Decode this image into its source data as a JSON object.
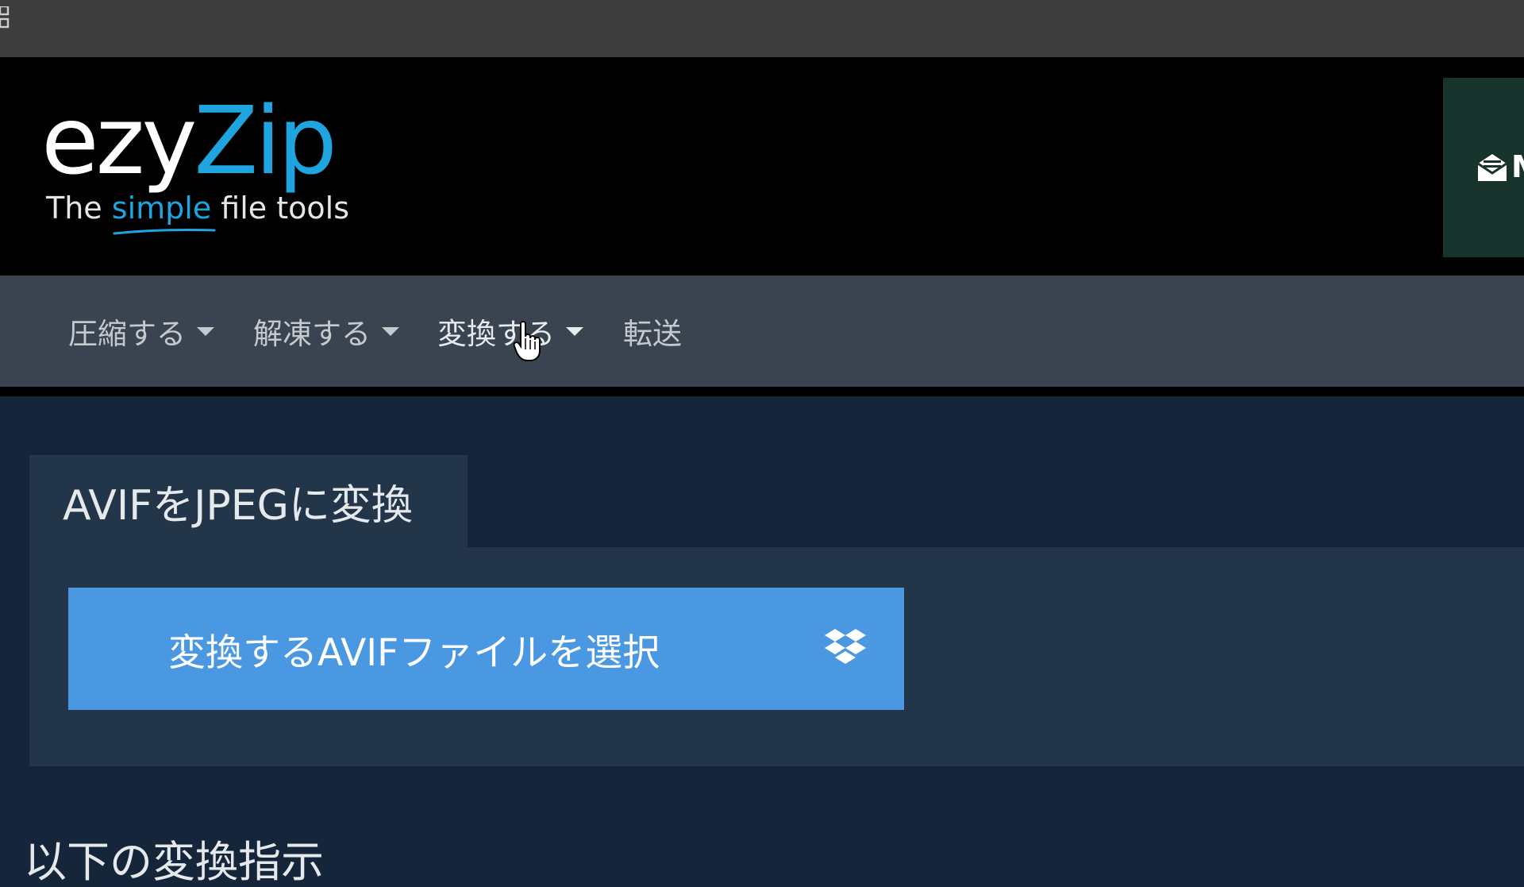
{
  "header": {
    "logo_ezy": "ezy",
    "logo_zip": "Zip",
    "tagline_before": "The ",
    "tagline_highlight": "simple",
    "tagline_after": " file tools",
    "login_letter": "M",
    "login_icon": "envelope-open-icon"
  },
  "nav": {
    "items": [
      {
        "label": "圧縮する",
        "has_dropdown": true
      },
      {
        "label": "解凍する",
        "has_dropdown": true
      },
      {
        "label": "変換する",
        "has_dropdown": true
      },
      {
        "label": "転送",
        "has_dropdown": false
      }
    ]
  },
  "main": {
    "tab_title": "AVIFをJPEGに変換",
    "select_button_label": "変換するAVIFファイルを選択",
    "dropbox_icon": "dropbox-icon",
    "below_heading": "以下の変換指示"
  },
  "colors": {
    "accent_blue": "#1ea5e0",
    "button_blue": "#4a98e2",
    "navbar": "#394450",
    "panel": "#223549",
    "page_bg": "#15263a"
  }
}
